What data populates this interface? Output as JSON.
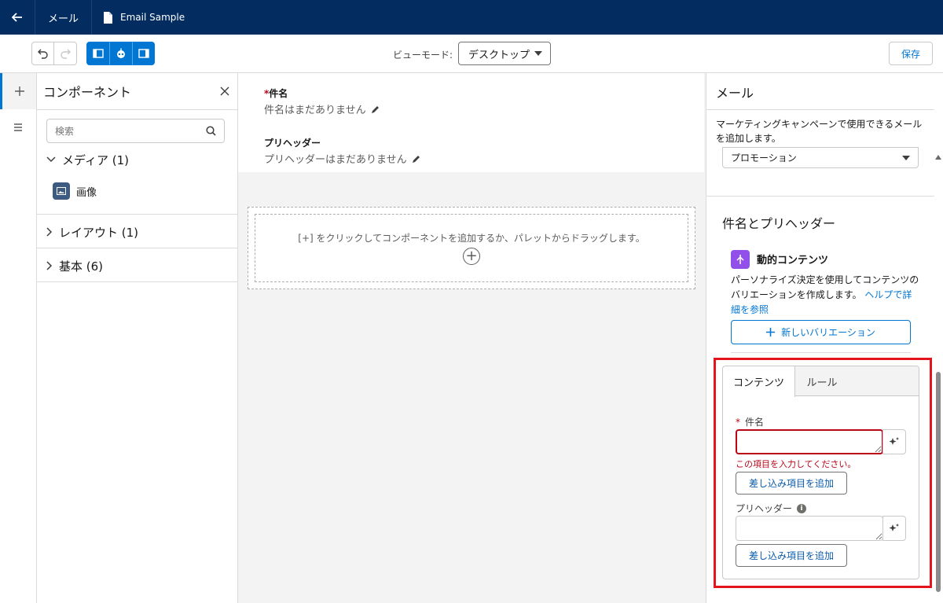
{
  "topbar": {
    "back_label": "戻る",
    "app": "メール",
    "file": "Email Sample"
  },
  "toolbar": {
    "view_mode_label": "ビューモード:",
    "view_mode_value": "デスクトップ",
    "save_label": "保存"
  },
  "components": {
    "title": "コンポーネント",
    "search_placeholder": "検索",
    "sections": [
      {
        "label": "メディア (1)",
        "expanded": true,
        "items": [
          {
            "label": "画像",
            "icon": "image-icon"
          }
        ]
      },
      {
        "label": "レイアウト (1)",
        "expanded": false
      },
      {
        "label": "基本 (6)",
        "expanded": false
      }
    ]
  },
  "canvas": {
    "subject_label": "件名",
    "subject_placeholder": "件名はまだありません",
    "preheader_label": "プリヘッダー",
    "preheader_placeholder": "プリヘッダーはまだありません",
    "drop_hint": "[+] をクリックしてコンポーネントを追加するか、パレットからドラッグします。"
  },
  "right_panel": {
    "title": "メール",
    "description": "マーケティングキャンペーンで使用できるメールを追加します。",
    "type_value": "プロモーション",
    "section_title": "件名とプリヘッダー",
    "dynamic": {
      "title": "動的コンテンツ",
      "description": "パーソナライズ決定を使用してコンテンツのバリエーションを作成します。",
      "help_link": "ヘルプで詳細を参照",
      "new_variation": "新しいバリエーション"
    },
    "tabs": [
      {
        "label": "コンテンツ",
        "active": true
      },
      {
        "label": "ルール",
        "active": false
      }
    ],
    "form": {
      "subject_label": "件名",
      "subject_value": "",
      "error": "この項目を入力してください。",
      "merge_button": "差し込み項目を追加",
      "preheader_label": "プリヘッダー",
      "preheader_value": "",
      "merge_button_2": "差し込み項目を追加"
    }
  },
  "colors": {
    "header": "#032d60",
    "brand": "#0176d3",
    "error": "#ba0517",
    "highlight": "#e3141e",
    "dynamic_icon": "#9050e9"
  }
}
